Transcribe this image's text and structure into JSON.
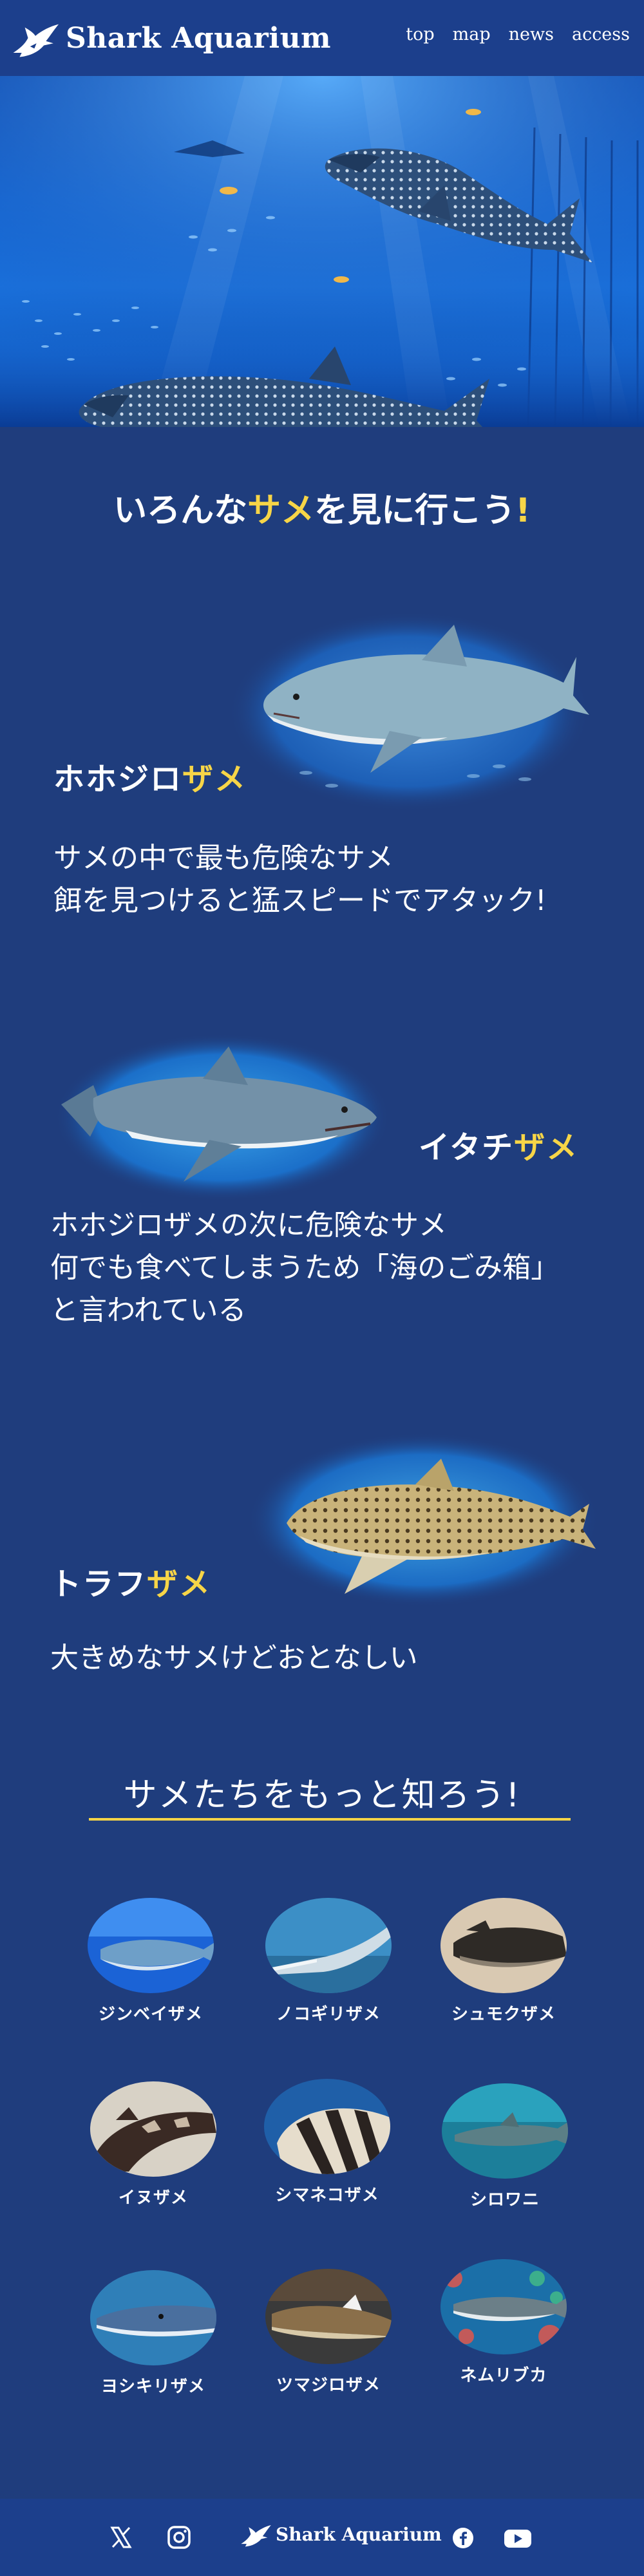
{
  "header": {
    "logo_text": "Shark Aquarium",
    "nav": [
      "top",
      "map",
      "news",
      "access"
    ]
  },
  "hero": {
    "image": "whale-shark-aquarium-photo"
  },
  "intro": {
    "title_before": "いろんな",
    "title_accent": "サメ",
    "title_after": "を見に行こう",
    "title_mark": "!"
  },
  "features": [
    {
      "name_main": "ホホジロ",
      "name_accent": "ザメ",
      "description": "サメの中で最も危険なサメ\n餌を見つけると猛スピードでアタック!"
    },
    {
      "name_main": "イタチ",
      "name_accent": "ザメ",
      "description": "ホホジロザメの次に危険なサメ\n何でも食べてしまうため「海のごみ箱」\nと言われている"
    },
    {
      "name_main": "トラフ",
      "name_accent": "ザメ",
      "description": "大きめなサメけどおとなしい"
    }
  ],
  "more": {
    "title": "サメたちをもっと知ろう!",
    "items": [
      {
        "label": "ジンベイザメ"
      },
      {
        "label": "ノコギリザメ"
      },
      {
        "label": "シュモクザメ"
      },
      {
        "label": "イヌザメ"
      },
      {
        "label": "シマネコザメ"
      },
      {
        "label": "シロワニ"
      },
      {
        "label": "ヨシキリザメ"
      },
      {
        "label": "ツマジロザメ"
      },
      {
        "label": "ネムリブカ"
      }
    ]
  },
  "footer": {
    "logo_text": "Shark Aquarium",
    "icons": [
      "x-icon",
      "instagram-icon",
      "facebook-icon",
      "youtube-icon"
    ]
  },
  "colors": {
    "background": "#1f3d7d",
    "header": "#1c3f8c",
    "accent": "#f7d547"
  }
}
